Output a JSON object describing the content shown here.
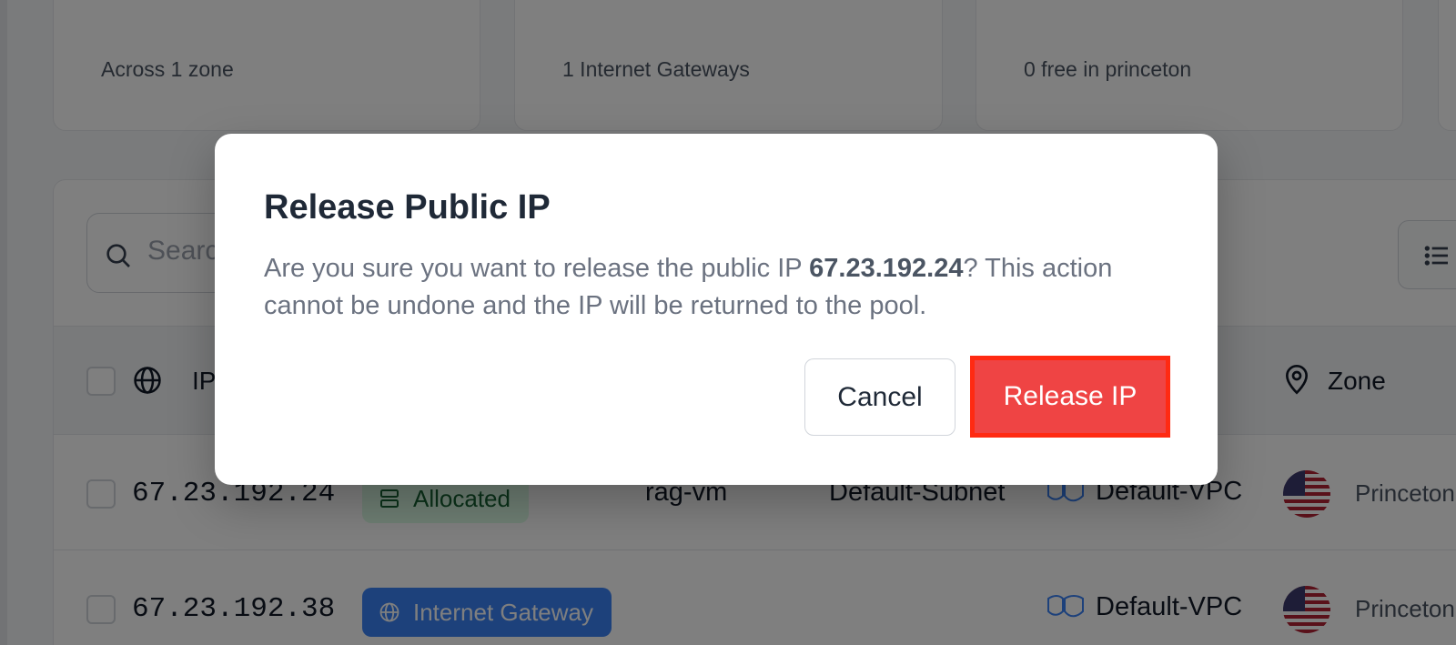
{
  "stats": [
    {
      "subtitle": "Across 1 zone"
    },
    {
      "subtitle": "1 Internet Gateways"
    },
    {
      "subtitle": "0 free in princeton"
    }
  ],
  "toolbar": {
    "search_placeholder": "Search"
  },
  "table": {
    "headers": {
      "ip": "IP",
      "zone": "Zone"
    },
    "rows": [
      {
        "ip": "67.23.192.24",
        "status": "Allocated",
        "resource": "rag-vm",
        "subnet": "Default-Subnet",
        "vpc": "Default-VPC",
        "zone": "Princeton"
      },
      {
        "ip": "67.23.192.38",
        "status": "Internet Gateway",
        "resource": "",
        "subnet": "",
        "vpc": "Default-VPC",
        "zone": "Princeton"
      }
    ]
  },
  "modal": {
    "title": "Release Public IP",
    "body_prefix": "Are you sure you want to release the public IP ",
    "ip": "67.23.192.24",
    "body_suffix": "? This action cannot be undone and the IP will be returned to the pool.",
    "cancel_label": "Cancel",
    "confirm_label": "Release IP"
  },
  "colors": {
    "danger": "#ef4444",
    "highlight_border": "#ff2a12",
    "allocated_badge": "#dcfce7",
    "gateway_badge": "#3b82f6"
  }
}
